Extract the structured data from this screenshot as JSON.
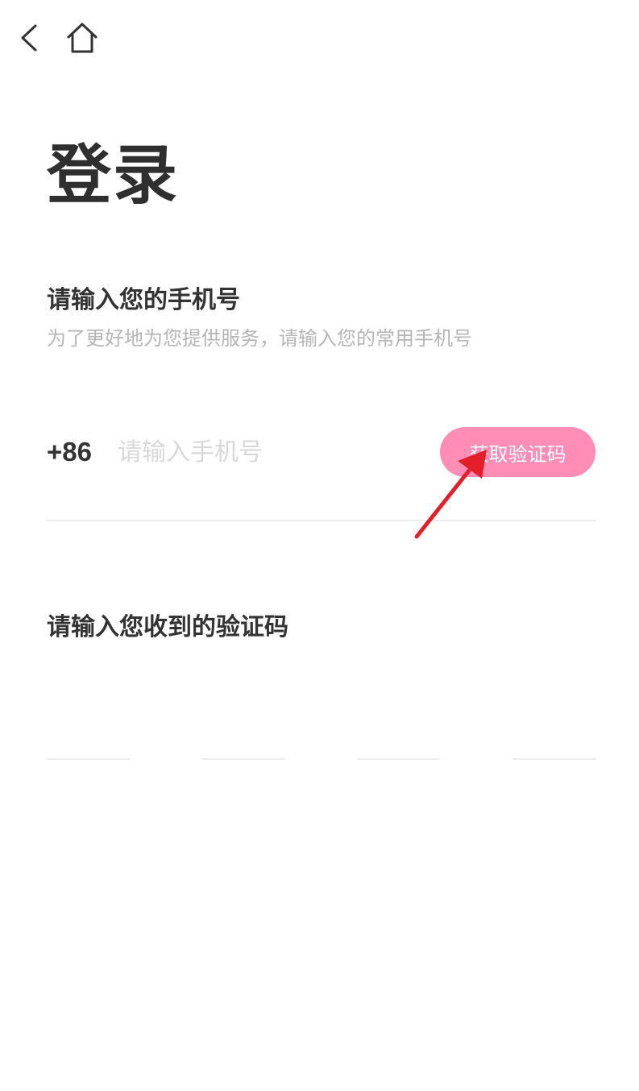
{
  "nav": {
    "back_icon": "chevron-left-icon",
    "home_icon": "home-icon"
  },
  "page": {
    "title": "登录"
  },
  "phone_section": {
    "title": "请输入您的手机号",
    "subtitle": "为了更好地为您提供服务，请输入您的常用手机号",
    "country_code": "+86",
    "input_value": "",
    "input_placeholder": "请输入手机号",
    "get_code_button": "获取验证码"
  },
  "code_section": {
    "title": "请输入您收到的验证码",
    "digits": [
      "",
      "",
      "",
      ""
    ]
  },
  "colors": {
    "background": "#ffffff",
    "title_text": "#2f2f2f",
    "body_text": "#333333",
    "hint_text": "#b5b5b5",
    "placeholder_text": "#d8d8d8",
    "button_background": "#ff8db6",
    "button_text": "#ffffff",
    "divider": "#ececec",
    "annotation_arrow": "#e3202a"
  }
}
